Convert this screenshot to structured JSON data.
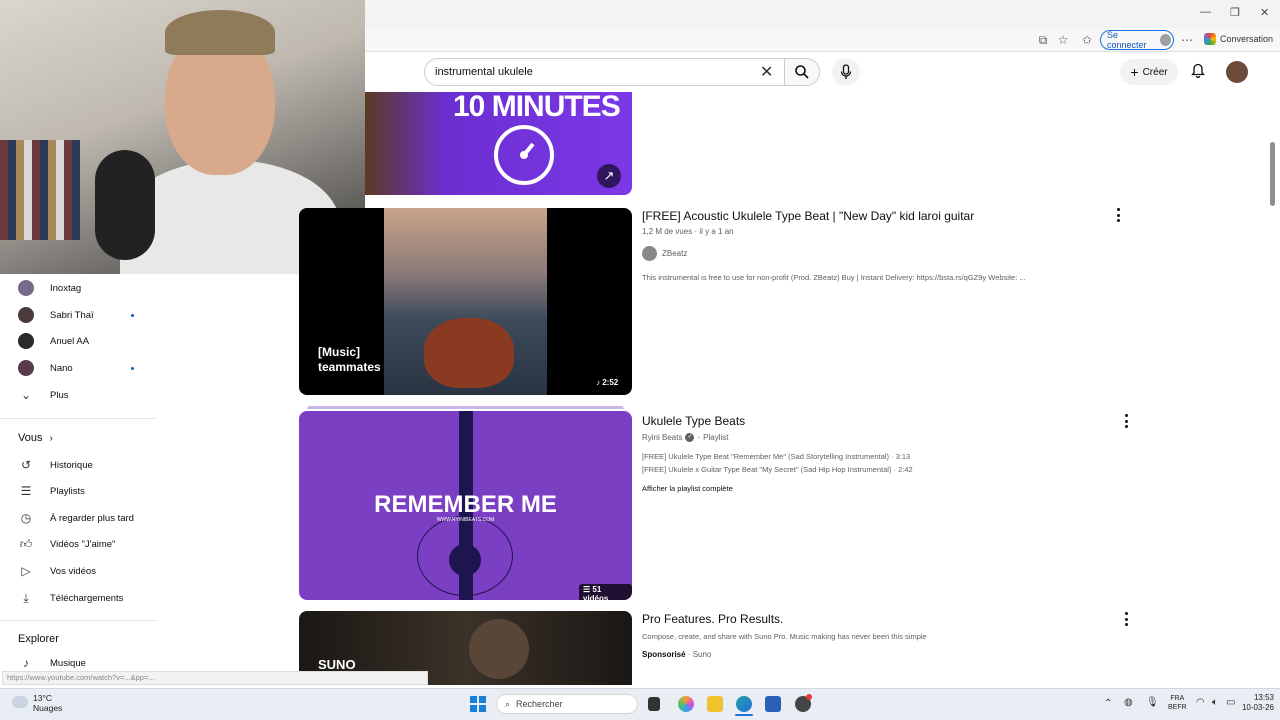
{
  "browser": {
    "signin_label": "Se connecter",
    "conversation_label": "Conversation"
  },
  "header": {
    "search_value": "instrumental ukulele",
    "create_label": "Créer"
  },
  "sidebar": {
    "subscriptions": [
      {
        "label": "Inoxtag",
        "dot": false,
        "color": "#7a6a8a"
      },
      {
        "label": "Sabri Thaï",
        "dot": true,
        "color": "#4a3a3a"
      },
      {
        "label": "Anuel AA",
        "dot": false,
        "color": "#2a2a2a"
      },
      {
        "label": "Nano",
        "dot": true,
        "color": "#5a3a4a"
      }
    ],
    "more_label": "Plus",
    "you_heading": "Vous",
    "you_items": [
      {
        "label": "Historique",
        "icon": "history-icon"
      },
      {
        "label": "Playlists",
        "icon": "playlists-icon"
      },
      {
        "label": "À regarder plus tard",
        "icon": "clock-icon"
      },
      {
        "label": "Vidéos \"J'aime\"",
        "icon": "thumb-up-icon"
      },
      {
        "label": "Vos vidéos",
        "icon": "video-icon"
      },
      {
        "label": "Téléchargements",
        "icon": "download-icon"
      }
    ],
    "explore_heading": "Explorer",
    "explore_items": [
      {
        "label": "Musique",
        "icon": "music-note-icon"
      }
    ]
  },
  "results": {
    "top_thumb_text": "10 MINUTES",
    "video1": {
      "title": "[FREE] Acoustic Ukulele Type Beat | \"New Day\" kid laroi guitar",
      "views": "1,2 M de vues",
      "age": "il y a 1 an",
      "channel": "ZBeatz",
      "description": "This instrumental is free to use for non-profit (Prod. ZBeatz) Buy | Instant Delivery: https://bsta.rs/qGZ9y Website: ...",
      "overlay": "[Music]\nteammates",
      "duration": "2:52"
    },
    "playlist": {
      "title": "Ukulele Type Beats",
      "channel": "Ryini Beats",
      "type": "Playlist",
      "thumb_text": "REMEMBER ME",
      "thumb_subtext": "WWW.RYINIBEATS.COM",
      "count": "51 vidéos",
      "items": [
        "[FREE] Ukulele Type Beat \"Remember Me\" (Sad Storytelling Instrumental) · 3:13",
        "[FREE] Ukulele x Guitar Type Beat \"My Secret\" (Sad Hip Hop Instrumental) · 2:42"
      ],
      "view_all": "Afficher la playlist complète"
    },
    "ad": {
      "title": "Pro Features. Pro Results.",
      "description": "Compose, create, and share with Suno Pro. Music making has never been this simple",
      "sponsored": "Sponsorisé",
      "advertiser": "Suno",
      "thumb_text": "SUNO"
    }
  },
  "statusbar": {
    "url": "https://www.youtube.com/watch?v=...&pp=..."
  },
  "taskbar": {
    "weather_temp": "13°C",
    "weather_desc": "Nuages",
    "search_placeholder": "Rechercher",
    "lang_top": "FRA",
    "lang_bottom": "BEFR",
    "time": "13:53",
    "date": "10-03-26"
  }
}
